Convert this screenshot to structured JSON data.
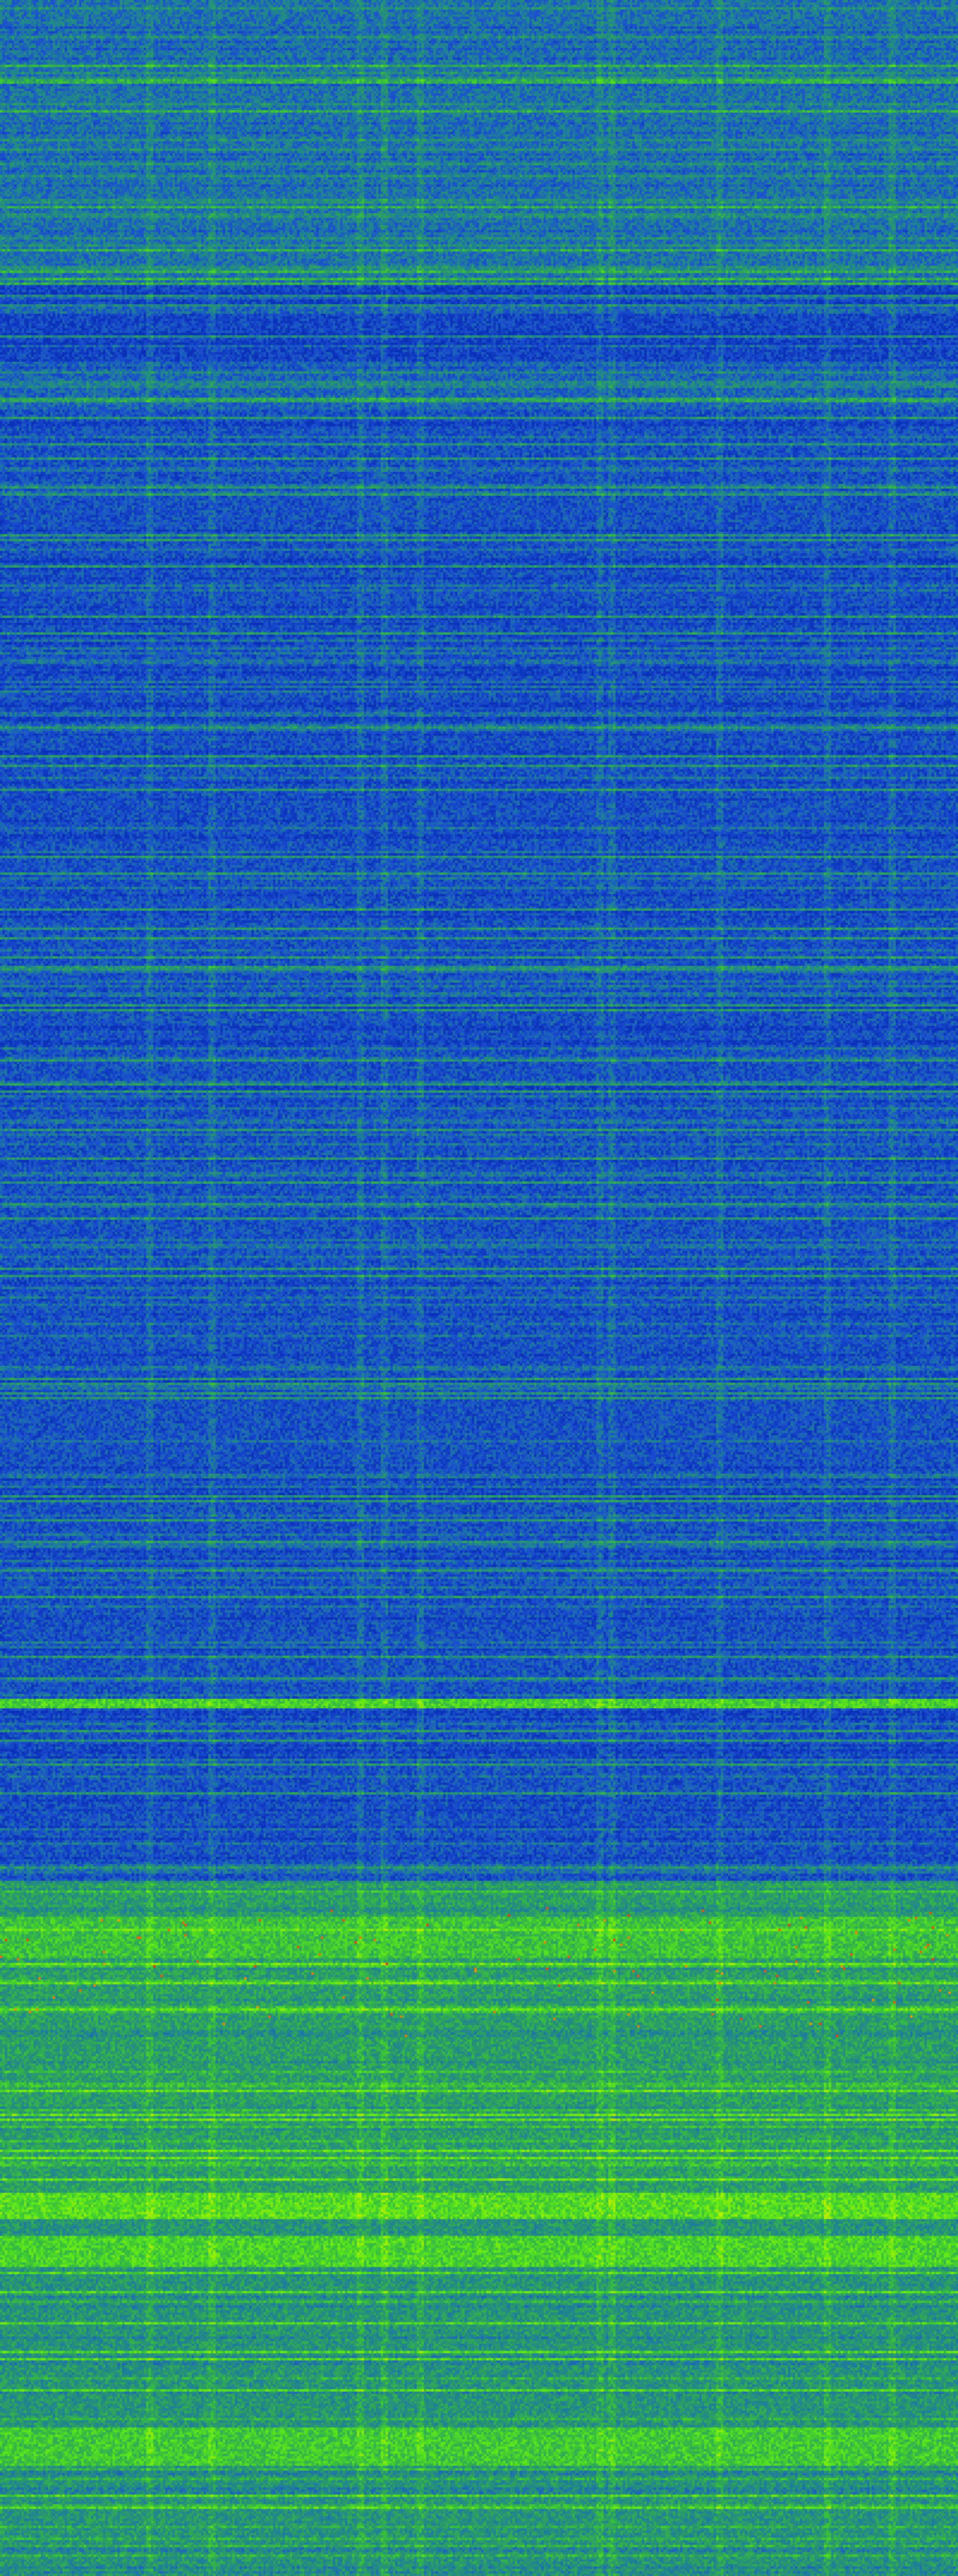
{
  "image": {
    "kind": "spectrogram-waterfall",
    "colormap": [
      "#0a2fb8",
      "#1a4fd0",
      "#1f7f9a",
      "#2a9a6a",
      "#39c23a",
      "#5ee81a",
      "#b8f000",
      "#f0c000",
      "#e03a10"
    ],
    "palette": {
      "background_blue": "#0a2fb8",
      "mid_teal": "#2a8f7a",
      "bright_green": "#12f000",
      "yellow": "#e8e000",
      "hot_red": "#e03a10"
    }
  }
}
